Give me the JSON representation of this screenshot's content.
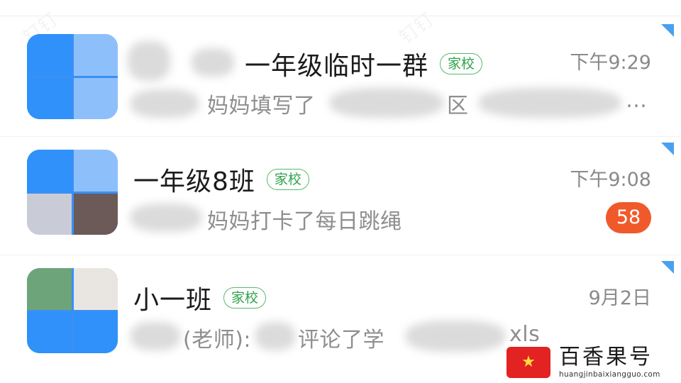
{
  "chats": [
    {
      "name": "一年级临时一群",
      "tag": "家校",
      "time": "下午9:29",
      "preview": "妈妈填写了",
      "preview_tail": "区",
      "preview_end": "…"
    },
    {
      "name": "一年级8班",
      "tag": "家校",
      "time": "下午9:08",
      "preview": "妈妈打卡了每日跳绳",
      "unread": "58"
    },
    {
      "name": "小一班",
      "tag": "家校",
      "time": "9月2日",
      "preview": "(老师):",
      "preview_mid": "评论了学",
      "preview_end": "xls"
    }
  ],
  "brand": {
    "name": "百香果号",
    "url": "huangjinbaixiangguo.com"
  },
  "colors": {
    "tag_green": "#2fa34a",
    "badge_orange": "#f05a2a",
    "avatar_blue": "#3390f3",
    "pin_blue": "#4aa0f0",
    "brand_red": "#e32222"
  }
}
